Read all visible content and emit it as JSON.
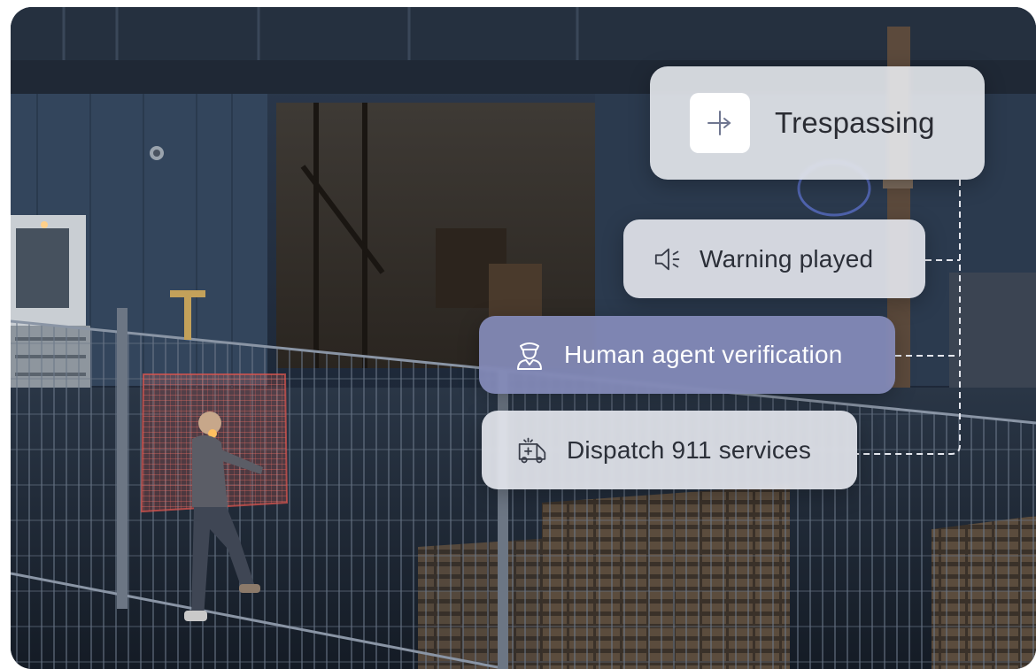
{
  "alerts": {
    "main": {
      "label": "Trespassing",
      "icon": "arrow-split-icon"
    },
    "steps": [
      {
        "label": "Warning played",
        "icon": "speaker-icon"
      },
      {
        "label": "Human agent verification",
        "icon": "security-guard-icon"
      },
      {
        "label": "Dispatch 911 services",
        "icon": "ambulance-icon"
      }
    ]
  },
  "colors": {
    "card_light": "#eceef3",
    "card_active": "#868cbb",
    "text_dark": "#2a2c33",
    "detection_box": "#e0564f"
  }
}
